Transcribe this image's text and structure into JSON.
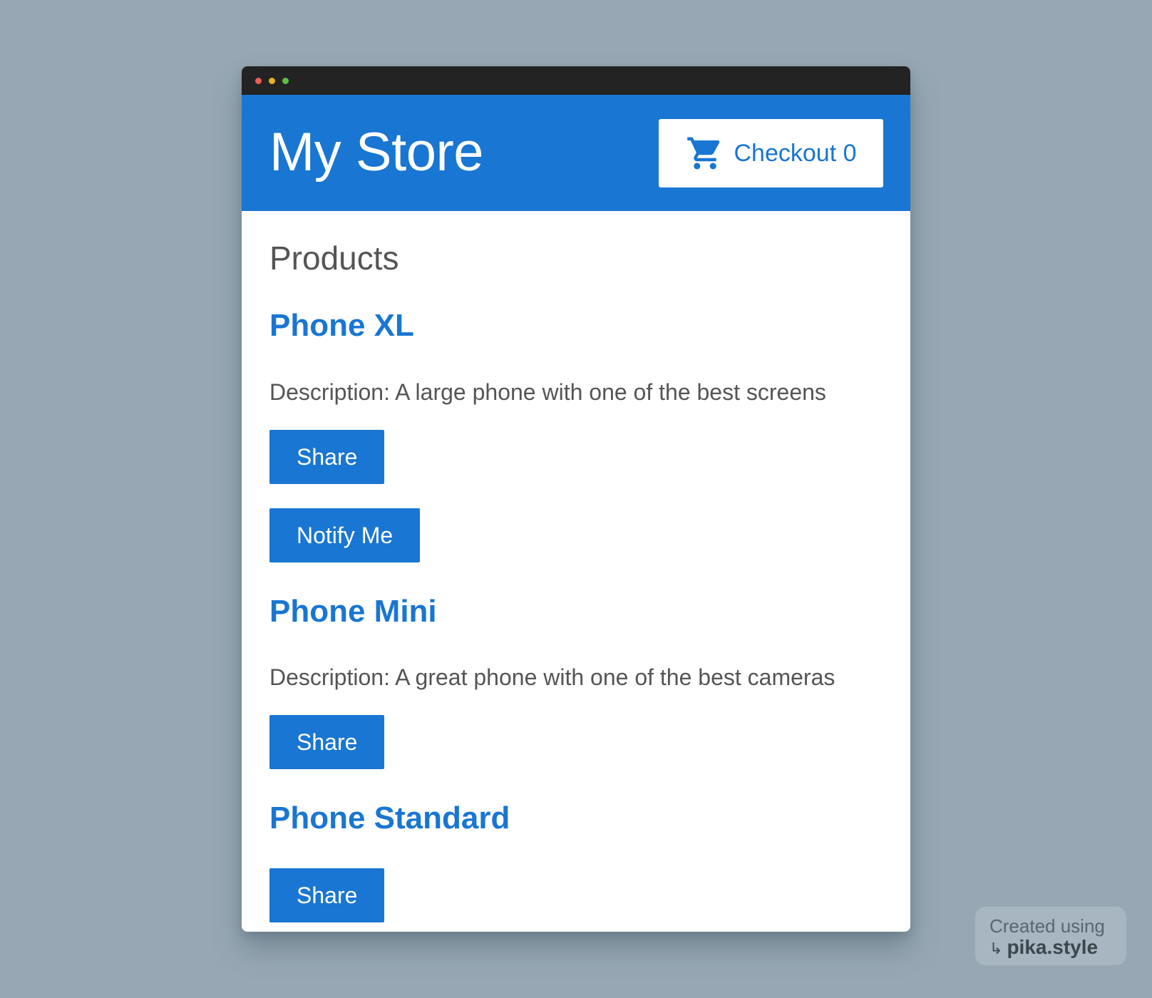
{
  "window": {
    "controls": [
      "close",
      "minimize",
      "maximize"
    ]
  },
  "header": {
    "title": "My Store",
    "checkout_label": "Checkout 0",
    "checkout_icon": "shopping-cart-icon"
  },
  "main": {
    "section_title": "Products",
    "products": [
      {
        "name": "Phone XL",
        "description": "Description: A large phone with one of the best screens",
        "buttons": [
          "Share",
          "Notify Me"
        ]
      },
      {
        "name": "Phone Mini",
        "description": "Description: A great phone with one of the best cameras",
        "buttons": [
          "Share"
        ]
      },
      {
        "name": "Phone Standard",
        "buttons": [
          "Share"
        ]
      }
    ]
  },
  "watermark": {
    "line1": "Created using",
    "line2": "pika.style"
  },
  "colors": {
    "primary": "#1976d2",
    "background": "#97a8b4",
    "titlebar": "#232323",
    "text_muted": "#555555"
  }
}
